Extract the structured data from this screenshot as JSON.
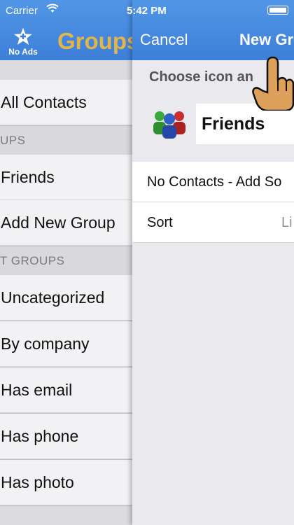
{
  "status": {
    "carrier": "Carrier",
    "time": "5:42 PM"
  },
  "left_nav": {
    "no_ads_label": "No Ads",
    "title": "Groups"
  },
  "left_list": {
    "all_contacts": "All Contacts",
    "section1": "UPS",
    "friends": "Friends",
    "add_new_group": "Add New Group",
    "section2": "T GROUPS",
    "items": [
      "Uncategorized",
      "By company",
      "Has email",
      "Has phone",
      "Has photo"
    ]
  },
  "right_nav": {
    "cancel": "Cancel",
    "title": "New Gro"
  },
  "right": {
    "choose_label": "Choose icon an",
    "group_name": "Friends",
    "no_contacts": "No Contacts - Add So",
    "sort_label": "Sort",
    "sort_value": "Li"
  },
  "colors": {
    "nav_blue": "#4589de",
    "title_gold": "#e0b64a"
  }
}
